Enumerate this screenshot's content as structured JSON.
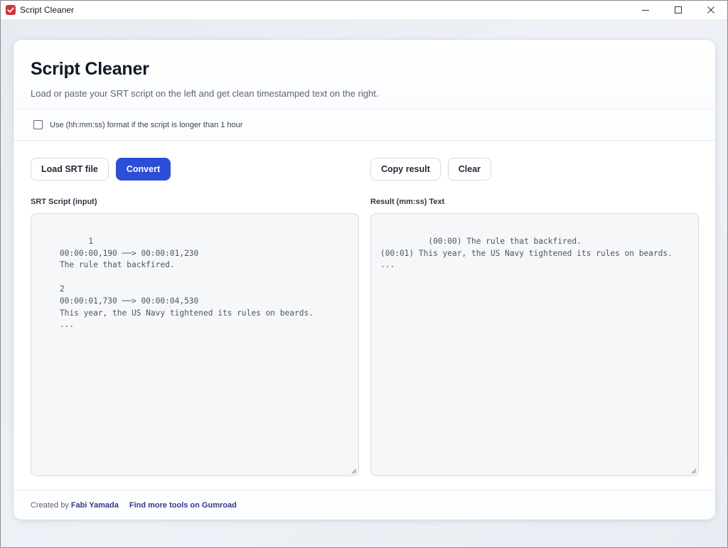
{
  "window": {
    "title": "Script Cleaner"
  },
  "header": {
    "title": "Script Cleaner",
    "subtitle": "Load or paste your SRT script on the left and get clean timestamped text on the right."
  },
  "options": {
    "hour_format_label": "Use (hh:mm:ss) format if the script is longer than 1 hour",
    "hour_format_checked": false
  },
  "left": {
    "load_label": "Load SRT file",
    "convert_label": "Convert",
    "input_label": "SRT Script (input)",
    "input_value": "1\n    00:00:00,190 ──> 00:00:01,230\n    The rule that backfired.\n\n    2\n    00:00:01,730 ──> 00:00:04,530\n    This year, the US Navy tightened its rules on beards.\n    ..."
  },
  "right": {
    "copy_label": "Copy result",
    "clear_label": "Clear",
    "result_label": "Result (mm:ss) Text",
    "result_value": "(00:00) The rule that backfired.\n(00:01) This year, the US Navy tightened its rules on beards.\n..."
  },
  "footer": {
    "created_by": "Created by",
    "author": "Fabi Yamada",
    "more_tools": "Find more tools on Gumroad"
  },
  "colors": {
    "primary": "#2b4ed6",
    "app_icon": "#d13438"
  },
  "icons": {
    "app": "checkmark-icon",
    "minimize": "minimize-icon",
    "maximize": "maximize-icon",
    "close": "close-icon"
  }
}
